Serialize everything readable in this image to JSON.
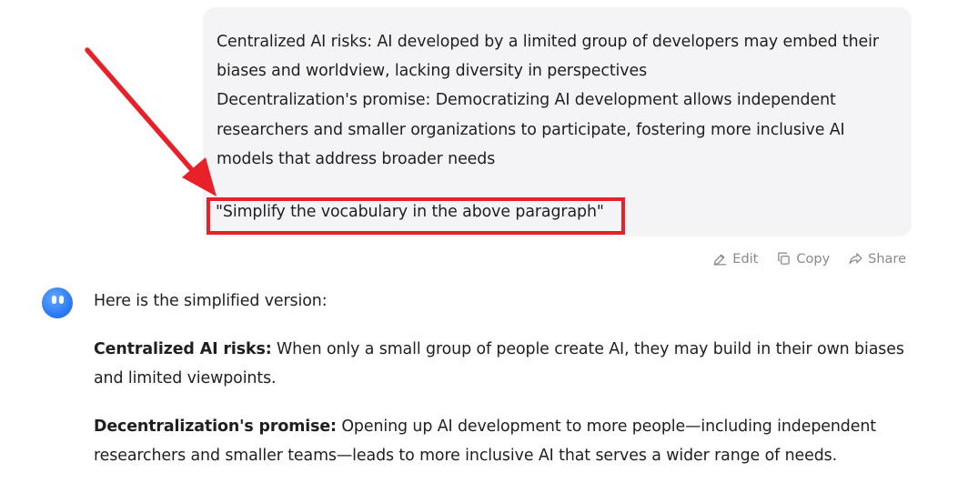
{
  "user_message": {
    "line1": "Centralized AI risks: AI developed by a limited group of developers may embed their biases and worldview, lacking diversity in perspectives",
    "line2": "Decentralization's promise: Democratizing AI development allows independent researchers and smaller organizations to participate, fostering more inclusive AI models that address broader needs",
    "instruction": "\"Simplify the vocabulary in the above paragraph\""
  },
  "message_actions": {
    "edit_label": "Edit",
    "copy_label": "Copy",
    "share_label": "Share"
  },
  "assistant_message": {
    "intro": "Here is the simplified version:",
    "point1_label": "Centralized AI risks:",
    "point1_text": " When only a small group of people create AI, they may build in their own biases and limited viewpoints.",
    "point2_label": "Decentralization's promise:",
    "point2_text": " Opening up AI development to more people—including independent researchers and smaller teams—leads to more inclusive AI that serves a wider range of needs."
  },
  "colors": {
    "annotation_red": "#e8202a",
    "bubble_bg": "#f4f4f6",
    "avatar_blue": "#2d7cf6"
  }
}
